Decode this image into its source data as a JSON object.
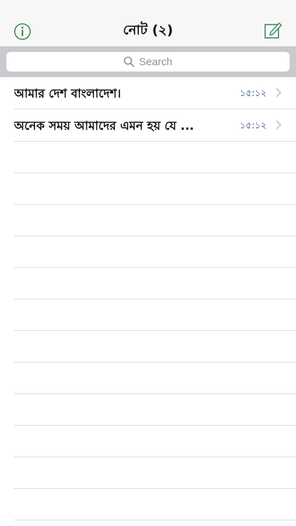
{
  "header": {
    "title": "নোট (২)"
  },
  "search": {
    "placeholder": "Search"
  },
  "notes": [
    {
      "title": "আমার দেশ বাংলাদেশ।",
      "time": "১৫:১২"
    },
    {
      "title": "অনেক সময় আমাদের এমন হয় যে ...",
      "time": "১৫:১২"
    }
  ],
  "colors": {
    "accent": "#3a8a5a",
    "time_text": "#2c4a78",
    "search_bar_bg": "#c9c9ce"
  }
}
